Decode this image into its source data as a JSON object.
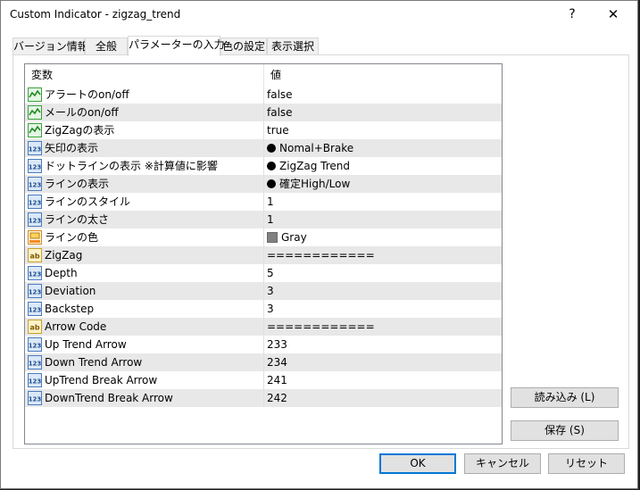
{
  "window": {
    "title": "Custom Indicator - zigzag_trend",
    "help_label": "?",
    "close_label": "✕"
  },
  "tabs": [
    {
      "label": "バージョン情報",
      "active": false
    },
    {
      "label": "全般",
      "active": false
    },
    {
      "label": "パラメーターの入力",
      "active": true
    },
    {
      "label": "色の設定",
      "active": false
    },
    {
      "label": "表示選択",
      "active": false
    }
  ],
  "grid": {
    "header_variable": "変数",
    "header_value": "値",
    "rows": [
      {
        "icon": "bool-icon",
        "name": "アラートのon/off",
        "value": "false"
      },
      {
        "icon": "bool-icon",
        "name": "メールのon/off",
        "value": "false"
      },
      {
        "icon": "bool-icon",
        "name": "ZigZagの表示",
        "value": "true"
      },
      {
        "icon": "number-icon",
        "name": "矢印の表示",
        "value": "Nomal+Brake",
        "dot": true
      },
      {
        "icon": "number-icon",
        "name": "ドットラインの表示 ※計算値に影響",
        "value": "ZigZag Trend",
        "dot": true
      },
      {
        "icon": "number-icon",
        "name": "ラインの表示",
        "value": "確定High/Low",
        "dot": true
      },
      {
        "icon": "number-icon",
        "name": "ラインのスタイル",
        "value": "1"
      },
      {
        "icon": "number-icon",
        "name": "ラインの太さ",
        "value": "1"
      },
      {
        "icon": "color-icon",
        "name": "ラインの色",
        "value": "Gray",
        "swatch": "#808080"
      },
      {
        "icon": "string-icon",
        "name": "ZigZag",
        "value": "============"
      },
      {
        "icon": "number-icon",
        "name": "Depth",
        "value": "5"
      },
      {
        "icon": "number-icon",
        "name": "Deviation",
        "value": "3"
      },
      {
        "icon": "number-icon",
        "name": "Backstep",
        "value": "3"
      },
      {
        "icon": "string-icon",
        "name": "Arrow Code",
        "value": "============"
      },
      {
        "icon": "number-icon",
        "name": "Up Trend Arrow",
        "value": "233"
      },
      {
        "icon": "number-icon",
        "name": "Down Trend Arrow",
        "value": "234"
      },
      {
        "icon": "number-icon",
        "name": "UpTrend Break Arrow",
        "value": "241"
      },
      {
        "icon": "number-icon",
        "name": "DownTrend Break Arrow",
        "value": "242"
      }
    ]
  },
  "buttons": {
    "load": "読み込み (L)",
    "save": "保存 (S)",
    "ok": "OK",
    "cancel": "キャンセル",
    "reset": "リセット"
  },
  "colors": {
    "accent": "#0078d7",
    "alt_row": "#e8e8e8",
    "gray_swatch": "#808080"
  }
}
